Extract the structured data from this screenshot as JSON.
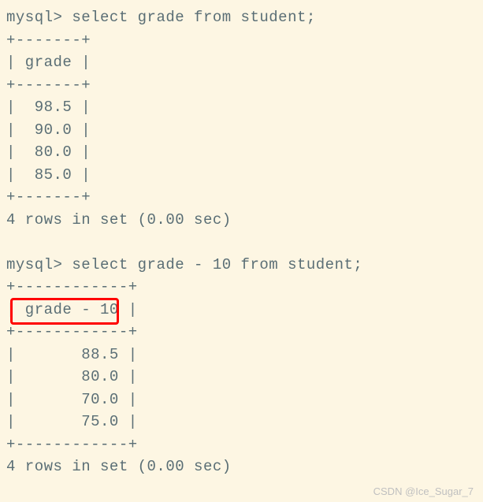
{
  "query1": {
    "prompt": "mysql>",
    "command": "select grade from student;",
    "border_top": "+-------+",
    "header": "| grade |",
    "border_mid": "+-------+",
    "rows": [
      "|  98.5 |",
      "|  90.0 |",
      "|  80.0 |",
      "|  85.0 |"
    ],
    "border_bottom": "+-------+",
    "status": "4 rows in set (0.00 sec)"
  },
  "query2": {
    "prompt": "mysql>",
    "command": "select grade - 10 from student;",
    "border_top": "+------------+",
    "header": "| grade - 10 |",
    "border_mid": "+------------+",
    "rows": [
      "|       88.5 |",
      "|       80.0 |",
      "|       70.0 |",
      "|       75.0 |"
    ],
    "border_bottom": "+------------+",
    "status": "4 rows in set (0.00 sec)"
  },
  "highlighted_header": "grade - 10",
  "watermark": "CSDN @Ice_Sugar_7",
  "chart_data": {
    "type": "table",
    "tables": [
      {
        "query": "select grade from student;",
        "columns": [
          "grade"
        ],
        "rows": [
          [
            98.5
          ],
          [
            90.0
          ],
          [
            80.0
          ],
          [
            85.0
          ]
        ],
        "row_count": 4,
        "time_sec": 0.0
      },
      {
        "query": "select grade - 10 from student;",
        "columns": [
          "grade - 10"
        ],
        "rows": [
          [
            88.5
          ],
          [
            80.0
          ],
          [
            70.0
          ],
          [
            75.0
          ]
        ],
        "row_count": 4,
        "time_sec": 0.0
      }
    ]
  }
}
